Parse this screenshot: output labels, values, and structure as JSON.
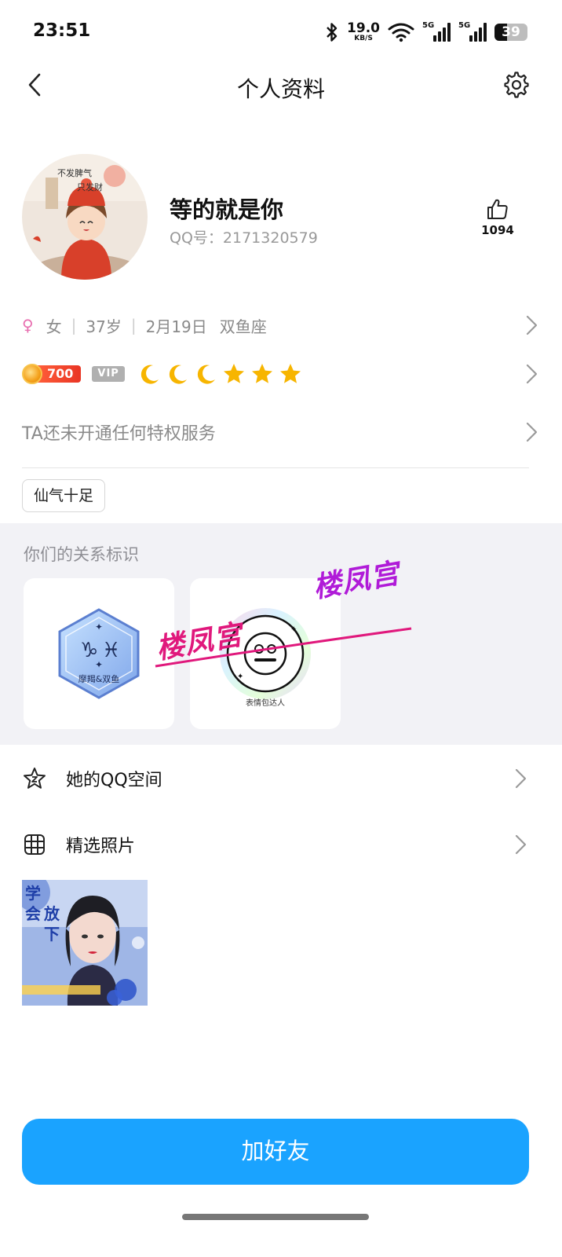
{
  "status": {
    "time": "23:51",
    "net_speed": "19.0",
    "net_unit": "KB/S",
    "sim1_label": "5G",
    "sim2_label": "5G",
    "battery": "39",
    "battery_level": 0.39
  },
  "nav": {
    "title": "个人资料"
  },
  "profile": {
    "nickname": "等的就是你",
    "qq_number": "QQ号：2171320579",
    "likes": "1094",
    "avatar_caption_1": "不发脾气",
    "avatar_caption_2": "只发财"
  },
  "basic_info": {
    "gender_icon": "♀",
    "gender": "女",
    "age": "37岁",
    "birthday": "2月19日",
    "zodiac": "双鱼座"
  },
  "level": {
    "coin_value": "700",
    "vip": "VIP",
    "icons": [
      "moon",
      "moon",
      "moon",
      "star",
      "star",
      "star"
    ]
  },
  "privilege": {
    "text": "TA还未开通任何特权服务"
  },
  "tags": [
    "仙气十足"
  ],
  "relation": {
    "title": "你们的关系标识",
    "badge1_label": "摩羯&双鱼",
    "badge2_label": "表情包达人",
    "watermark": "楼凤宫"
  },
  "menu": {
    "qzone": "她的QQ空间",
    "photos": "精选照片"
  },
  "photo_overlay": {
    "line1": "学",
    "line2": "会",
    "line3": "放",
    "line4": "下"
  },
  "action": {
    "add_friend": "加好友"
  },
  "colors": {
    "primary_button": "#1aa3ff",
    "female": "#e86fb0",
    "coin_badge": "#e93524",
    "level_icon": "#f7b500",
    "watermark": "#e0187c"
  }
}
